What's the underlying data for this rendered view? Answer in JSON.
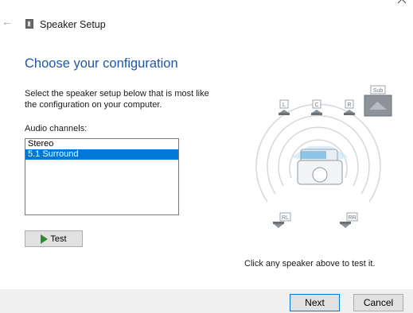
{
  "window": {
    "title": "Speaker Setup"
  },
  "page": {
    "heading": "Choose your configuration",
    "description_line1": "Select the speaker setup below that is most like",
    "description_line2": "the configuration on your computer.",
    "channels_label": "Audio channels:",
    "channels": [
      {
        "label": "Stereo",
        "selected": false
      },
      {
        "label": "5.1 Surround",
        "selected": true
      }
    ],
    "test_button": "Test",
    "hint": "Click any speaker above to test it."
  },
  "diagram": {
    "speakers": {
      "left": "L",
      "center": "C",
      "right": "R",
      "subwoofer": "Sub",
      "rear_left": "RL",
      "rear_right": "RR"
    }
  },
  "footer": {
    "next": "Next",
    "cancel": "Cancel"
  },
  "colors": {
    "heading": "#2056a8",
    "selection": "#0078d7",
    "footer_bg": "#f0f0f0",
    "play_icon": "#2e8b2e"
  },
  "icons": {
    "back": "back-arrow-icon",
    "app": "speaker-icon",
    "close": "close-icon",
    "test": "play-icon"
  }
}
